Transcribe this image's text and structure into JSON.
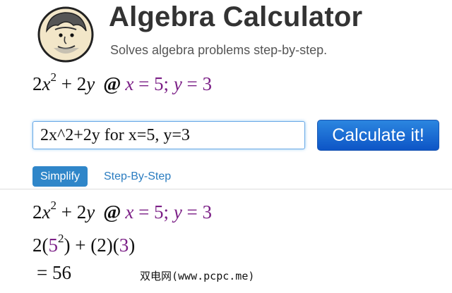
{
  "header": {
    "title": "Algebra Calculator",
    "subtitle": "Solves algebra problems step-by-step."
  },
  "preview": {
    "coef1": "2",
    "var1": "x",
    "exp1": "2",
    "plus": " + ",
    "coef2": "2",
    "var2": "y",
    "at": "@",
    "a_var": "x",
    "a_eq": " = ",
    "a_val": "5",
    "sep": "; ",
    "b_var": "y",
    "b_eq": " = ",
    "b_val": "3"
  },
  "input": {
    "value": "2x^2+2y for x=5, y=3"
  },
  "calculate_button": {
    "label": "Calculate it!"
  },
  "tabs": [
    {
      "label": "Simplify",
      "active": true
    },
    {
      "label": "Step-By-Step",
      "active": false
    }
  ],
  "result": {
    "line1": {
      "coef1": "2",
      "var1": "x",
      "exp1": "2",
      "plus": " + ",
      "coef2": "2",
      "var2": "y",
      "at": "@",
      "a_var": "x",
      "a_eq": " = ",
      "a_val": "5",
      "sep": "; ",
      "b_var": "y",
      "b_eq": " = ",
      "b_val": "3"
    },
    "line2": {
      "p1": "2(",
      "base": "5",
      "exp": "2",
      "p2": ") + (2)(",
      "val": "3",
      "p3": ")"
    },
    "line3": {
      "eq": "= ",
      "answer": "56"
    }
  },
  "watermark": "双电网(www.pcpc.me)",
  "colors": {
    "substitution": "#7b1f86",
    "button": "#1565d8",
    "active_tab": "#2f86c9",
    "link": "#2a7cc0"
  }
}
